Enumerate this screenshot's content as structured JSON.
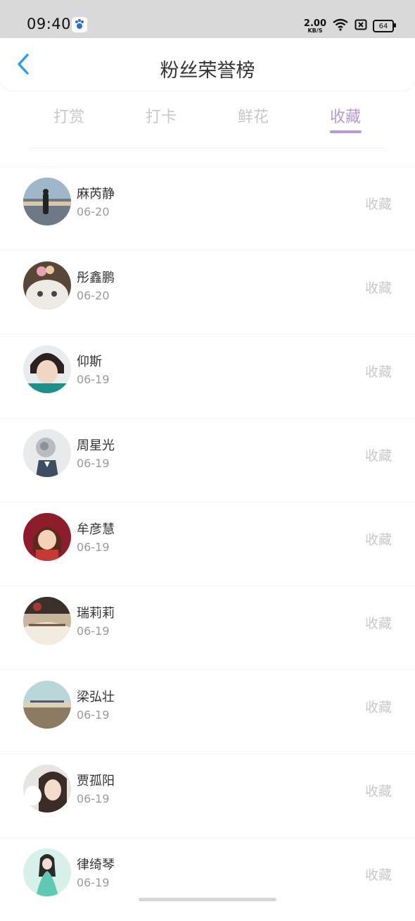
{
  "status_bar": {
    "time": "09:40",
    "net_speed_value": "2.00",
    "net_speed_unit": "KB/S",
    "battery": "64"
  },
  "header": {
    "title": "粉丝荣誉榜"
  },
  "tabs": [
    {
      "label": "打赏",
      "active": false
    },
    {
      "label": "打卡",
      "active": false
    },
    {
      "label": "鲜花",
      "active": false
    },
    {
      "label": "收藏",
      "active": true
    }
  ],
  "list": [
    {
      "name": "麻芮静",
      "date": "06-20",
      "action": "收藏"
    },
    {
      "name": "彤鑫鹏",
      "date": "06-20",
      "action": "收藏"
    },
    {
      "name": "仰斯",
      "date": "06-19",
      "action": "收藏"
    },
    {
      "name": "周星光",
      "date": "06-19",
      "action": "收藏"
    },
    {
      "name": "牟彦慧",
      "date": "06-19",
      "action": "收藏"
    },
    {
      "name": "瑞莉莉",
      "date": "06-19",
      "action": "收藏"
    },
    {
      "name": "梁弘壮",
      "date": "06-19",
      "action": "收藏"
    },
    {
      "name": "贾孤阳",
      "date": "06-19",
      "action": "收藏"
    },
    {
      "name": "律绮琴",
      "date": "06-19",
      "action": "收藏"
    }
  ],
  "colors": {
    "accent": "#b59ad9",
    "back_icon": "#2d9cf0",
    "status_bar_bg": "#d9d9d9"
  }
}
